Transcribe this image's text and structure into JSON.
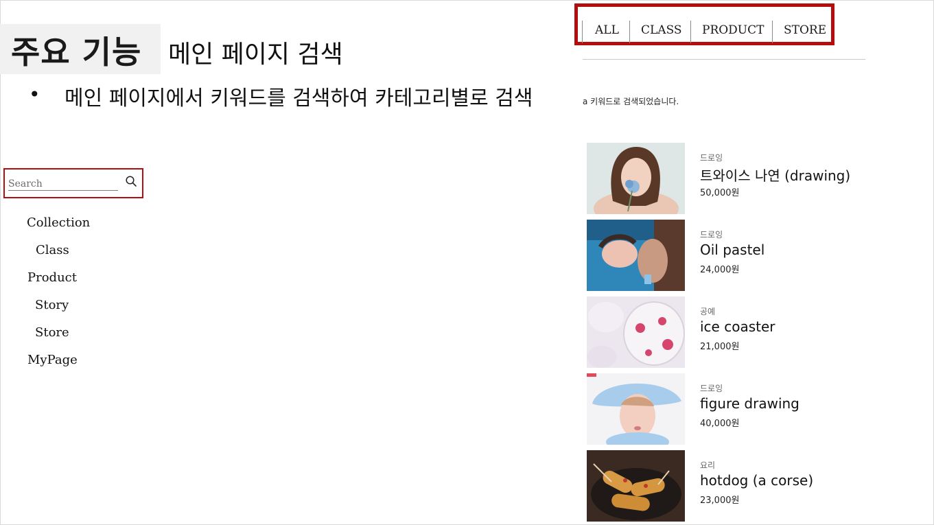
{
  "slide": {
    "heading_label": "주요 기능",
    "heading_subtitle": "메인 페이지 검색",
    "bullet": "메인 페이지에서 키워드를 검색하여 카테고리별로 검색"
  },
  "sidebar": {
    "search_placeholder": "Search",
    "items": [
      {
        "label": "Collection"
      },
      {
        "label": "Class"
      },
      {
        "label": "Product"
      },
      {
        "label": "Story"
      },
      {
        "label": "Store"
      },
      {
        "label": "MyPage"
      }
    ]
  },
  "tabs": [
    {
      "label": "ALL"
    },
    {
      "label": "CLASS"
    },
    {
      "label": "PRODUCT"
    },
    {
      "label": "STORE"
    }
  ],
  "results": {
    "message": "a 키워드로 검색되었습니다.",
    "items": [
      {
        "category": "드로잉",
        "title": "트와이스 나연 (drawing)",
        "price": "50,000원"
      },
      {
        "category": "드로잉",
        "title": "Oil pastel",
        "price": "24,000원"
      },
      {
        "category": "공예",
        "title": "ice coaster",
        "price": "21,000원"
      },
      {
        "category": "드로잉",
        "title": "figure drawing",
        "price": "40,000원"
      },
      {
        "category": "요리",
        "title": "hotdog (a corse)",
        "price": "23,000원"
      }
    ]
  },
  "colors": {
    "highlight": "#b40d0d",
    "heading_background": "#f1f1f1"
  }
}
